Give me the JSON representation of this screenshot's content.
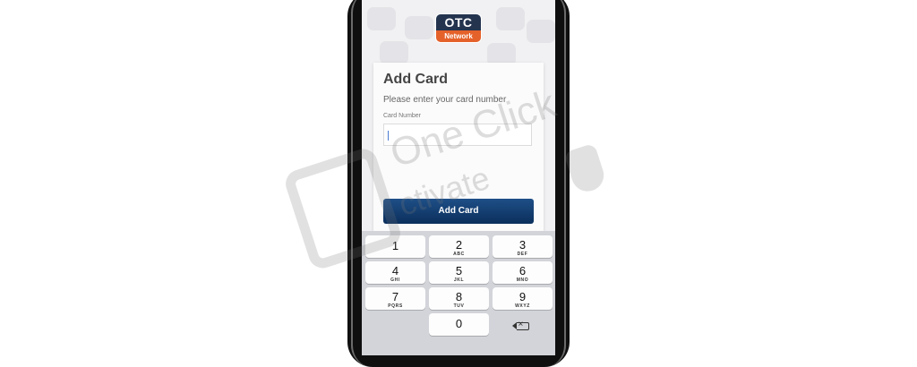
{
  "logo": {
    "top": "OTC",
    "bottom": "Network"
  },
  "card": {
    "title": "Add Card",
    "subtitle": "Please enter your card number",
    "field_label": "Card Number",
    "field_value": "",
    "button_label": "Add Card"
  },
  "keypad": {
    "keys": [
      {
        "num": "1",
        "letters": ""
      },
      {
        "num": "2",
        "letters": "ABC"
      },
      {
        "num": "3",
        "letters": "DEF"
      },
      {
        "num": "4",
        "letters": "GHI"
      },
      {
        "num": "5",
        "letters": "JKL"
      },
      {
        "num": "6",
        "letters": "MNO"
      },
      {
        "num": "7",
        "letters": "PQRS"
      },
      {
        "num": "8",
        "letters": "TUV"
      },
      {
        "num": "9",
        "letters": "WXYZ"
      },
      {
        "num": "0",
        "letters": ""
      }
    ]
  },
  "watermark": {
    "line1": "One Click",
    "line2": "ctivate"
  },
  "colors": {
    "accent": "#0b2f5c",
    "logo_top": "#24344f",
    "logo_bottom": "#e5612a"
  }
}
